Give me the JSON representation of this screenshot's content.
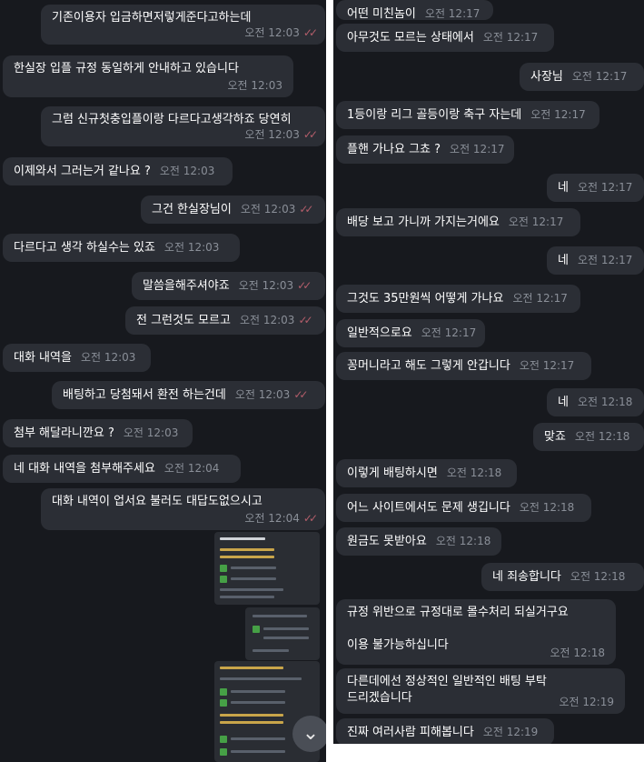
{
  "left": [
    {
      "text": "기존이용자 입금하면저렇게준다고하는데",
      "time": "오전 12:03",
      "sent": true
    },
    {
      "text": "한실장 입플 규정 동일하게 안내하고 있습니다",
      "time": "오전 12:03",
      "sent": false
    },
    {
      "text": "그럼 신규첫충입플이랑 다르다고생각하죠 당연히",
      "time": "오전 12:03",
      "sent": true
    },
    {
      "text": "이제와서 그러는거 같나요 ?",
      "time": "오전 12:03",
      "sent": false
    },
    {
      "text": "그건 한실장님이",
      "time": "오전 12:03",
      "sent": true
    },
    {
      "text": "다르다고 생각 하실수는 있죠",
      "time": "오전 12:03",
      "sent": false
    },
    {
      "text": "말씀을해주셔야죠",
      "time": "오전 12:03",
      "sent": true
    },
    {
      "text": "전 그런것도 모르고",
      "time": "오전 12:03",
      "sent": true
    },
    {
      "text": "대화 내역을",
      "time": "오전 12:03",
      "sent": false
    },
    {
      "text": "배팅하고 당첨돼서 환전 하는건데",
      "time": "오전 12:03",
      "sent": true
    },
    {
      "text": "첨부 해달라니깐요 ?",
      "time": "오전 12:03",
      "sent": false
    },
    {
      "text": "네 대화 내역을 첨부해주세요",
      "time": "오전 12:04",
      "sent": false
    },
    {
      "text": "대화 내역이 업서요 불러도 대답도없으시고",
      "time": "오전 12:04",
      "sent": true
    }
  ],
  "right": [
    {
      "text": "어떤 미친놈이",
      "time": "오전 12:17",
      "sent": false
    },
    {
      "text": "아무것도 모르는 상태에서",
      "time": "오전 12:17",
      "sent": false
    },
    {
      "text": "사장님",
      "time": "오전 12:17",
      "sent": true
    },
    {
      "text": "1등이랑 리그 골등이랑 축구 자는데",
      "time": "오전 12:17",
      "sent": false
    },
    {
      "text": "플핸 가나요 그쵸 ?",
      "time": "오전 12:17",
      "sent": false
    },
    {
      "text": "네",
      "time": "오전 12:17",
      "sent": true
    },
    {
      "text": "배당 보고 가니까 가지는거에요",
      "time": "오전 12:17",
      "sent": false
    },
    {
      "text": "네",
      "time": "오전 12:17",
      "sent": true
    },
    {
      "text": "그것도 35만원씩 어떻게 가나요",
      "time": "오전 12:17",
      "sent": false
    },
    {
      "text": "일반적으로요",
      "time": "오전 12:17",
      "sent": false
    },
    {
      "text": "꽁머니라고 해도 그렇게 안갑니다",
      "time": "오전 12:17",
      "sent": false
    },
    {
      "text": "네",
      "time": "오전 12:18",
      "sent": true
    },
    {
      "text": "맞죠",
      "time": "오전 12:18",
      "sent": true
    },
    {
      "text": "이렇게 배팅하시면",
      "time": "오전 12:18",
      "sent": false
    },
    {
      "text": "어느 사이트에서도 문제 생깁니다",
      "time": "오전 12:18",
      "sent": false
    },
    {
      "text": "원금도 못받아요",
      "time": "오전 12:18",
      "sent": false
    },
    {
      "text": "네 죄송합니다",
      "time": "오전 12:18",
      "sent": true
    },
    {
      "text": "규정 위반으로 규정대로 몰수처리 되실거구요\n\n이용 불가능하십니다",
      "time": "오전 12:18",
      "sent": false
    },
    {
      "text": "다른데에선 정상적인 일반적인 배팅 부탁\n드리겠습니다",
      "time": "오전 12:19",
      "sent": false
    },
    {
      "text": "진짜 여러사람 피해봅니다",
      "time": "오전 12:19",
      "sent": false
    }
  ],
  "check_glyph": "✓✓",
  "scroll_icon": "chevron-down-icon",
  "colors": {
    "background": "#17191e",
    "bubble": "#2b2e35",
    "time": "#8a8f98",
    "check": "#b25d6a"
  }
}
